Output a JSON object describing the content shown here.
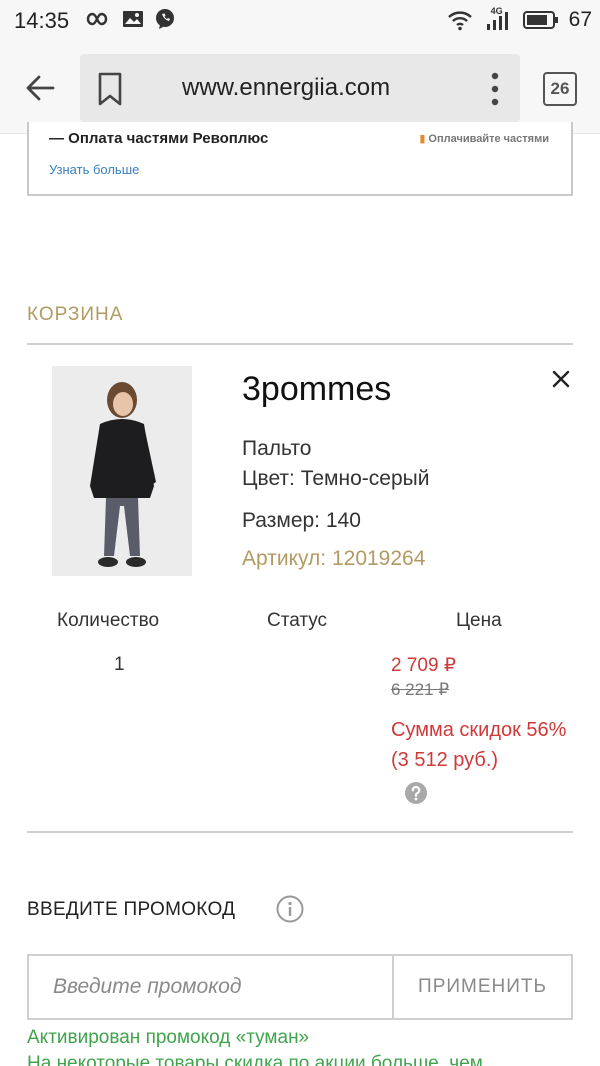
{
  "status_bar": {
    "time": "14:35",
    "battery": "67",
    "network": "4G",
    "icons_left": [
      "infinity-icon",
      "image-icon",
      "viber-icon"
    ],
    "icons_right": [
      "wifi-icon",
      "signal-icon",
      "battery-icon"
    ]
  },
  "browser": {
    "url": "www.ennergiia.com",
    "tab_count": "26"
  },
  "payment_card": {
    "title": "— Оплата частями Ревоплюс",
    "badge": "Оплачивайте частями",
    "link": "Узнать больше"
  },
  "cart": {
    "title": "КОРЗИНА",
    "item": {
      "brand": "3pommes",
      "name": "Пальто",
      "color": "Цвет: Темно-серый",
      "size": "Размер: 140",
      "article": "Артикул: 12019264"
    },
    "columns": {
      "quantity": "Количество",
      "status": "Статус",
      "price": "Цена"
    },
    "row": {
      "quantity": "1",
      "price_now": "2 709 ₽",
      "price_old": "6 221 ₽",
      "discount": "Сумма скидок 56% (3 512 руб.)"
    }
  },
  "promo": {
    "title": "ВВЕДИТЕ ПРОМОКОД",
    "placeholder": "Введите промокод",
    "apply_label": "ПРИМЕНИТЬ",
    "activated": "Активирован промокод «туман»",
    "note": "На некоторые товары скидка по акции больше, чем"
  },
  "colors": {
    "accent_gold": "#b29a62",
    "price_red": "#d0393a",
    "success_green": "#3fa44b",
    "link_blue": "#3b7fc4"
  }
}
